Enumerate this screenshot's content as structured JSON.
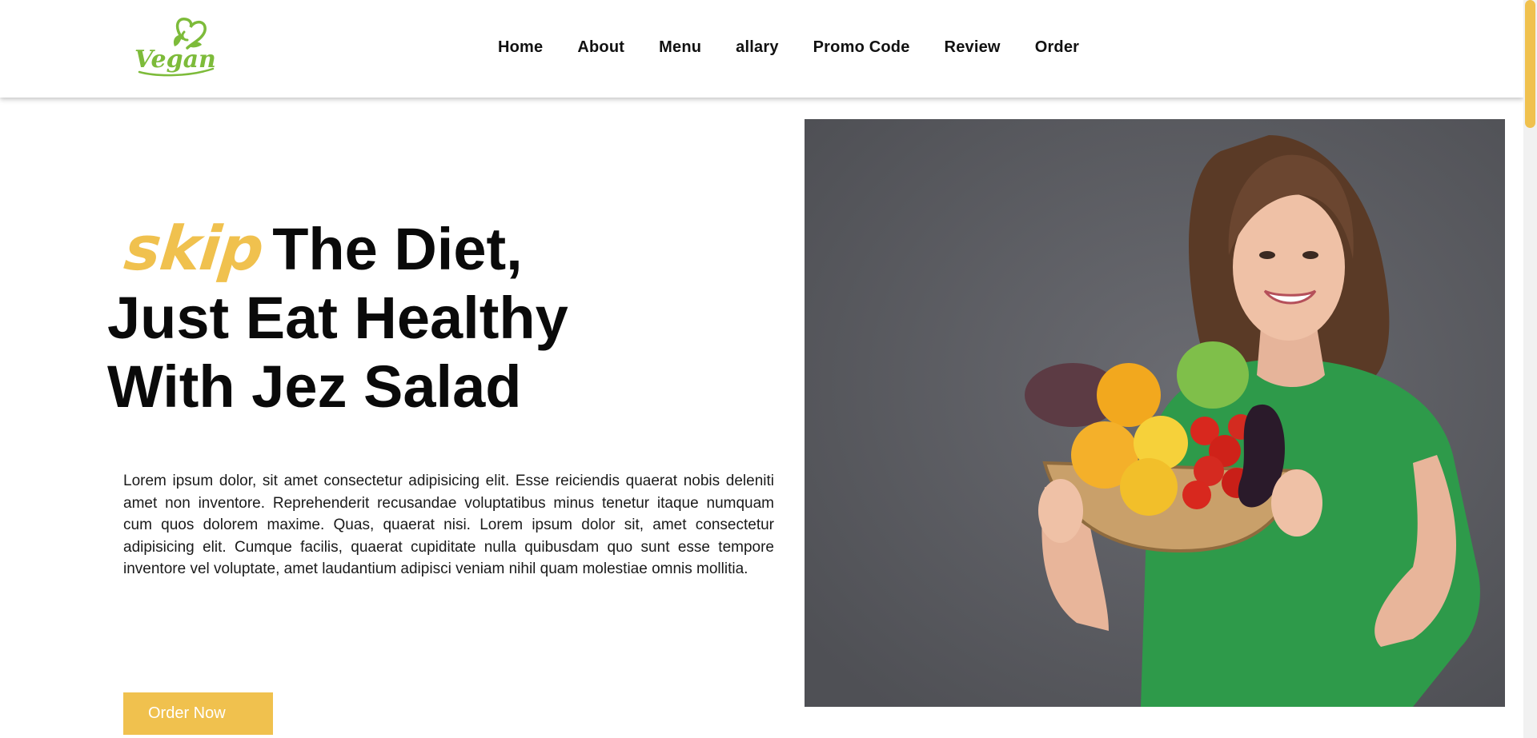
{
  "brand": {
    "logo_text": "Vegan",
    "logo_color": "#7dbb3a"
  },
  "nav": {
    "items": [
      {
        "label": "Home"
      },
      {
        "label": "About"
      },
      {
        "label": "Menu"
      },
      {
        "label": "allary"
      },
      {
        "label": "Promo Code"
      },
      {
        "label": "Review"
      },
      {
        "label": "Order"
      }
    ]
  },
  "hero": {
    "accent_word": "skip",
    "title_line_1": "The Diet,",
    "title_line_2": "Just Eat Healthy",
    "title_line_3": "With Jez Salad",
    "body": "Lorem ipsum dolor, sit amet consectetur adipisicing elit. Esse reiciendis quaerat nobis deleniti amet non inventore. Reprehenderit recusandae voluptatibus minus tenetur itaque numquam cum quos dolorem maxime. Quas, quaerat nisi. Lorem ipsum dolor sit, amet consectetur adipisicing elit. Cumque facilis, quaerat cupiditate nulla quibusdam quo sunt esse tempore inventore vel voluptate, amet laudantium adipisci veniam nihil quam molestiae omnis mollitia.",
    "cta_label": "Order Now",
    "image_subject": "woman-holding-vegetable-basket"
  },
  "colors": {
    "accent": "#f0c14e",
    "text": "#0a0a0a",
    "background": "#ffffff",
    "image_backdrop": "#5a5b60",
    "shirt": "#2e9a4a"
  }
}
